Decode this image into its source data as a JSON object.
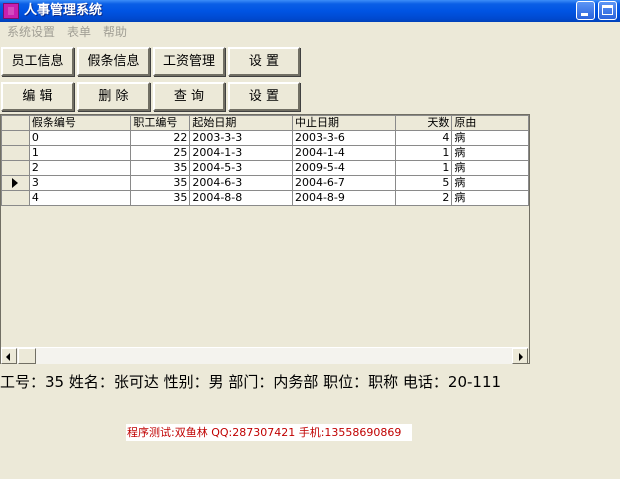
{
  "window": {
    "title": "人事管理系统"
  },
  "menu": [
    "系统设置",
    "表单",
    "帮助"
  ],
  "toolbar_row1": [
    "员工信息",
    "假条信息",
    "工资管理",
    "设  置"
  ],
  "toolbar_row2": [
    "编  辑",
    "删  除",
    "查  询",
    "设  置"
  ],
  "table": {
    "columns": [
      "假条编号",
      "职工编号",
      "起始日期",
      "中止日期",
      "天数",
      "原由"
    ],
    "rows": [
      [
        "0",
        "22",
        "2003-3-3",
        "2003-3-6",
        "4",
        "病"
      ],
      [
        "1",
        "25",
        "2004-1-3",
        "2004-1-4",
        "1",
        "病"
      ],
      [
        "2",
        "35",
        "2004-5-3",
        "2009-5-4",
        "1",
        "病"
      ],
      [
        "3",
        "35",
        "2004-6-3",
        "2004-6-7",
        "5",
        "病"
      ],
      [
        "4",
        "35",
        "2004-8-8",
        "2004-8-9",
        "2",
        "病"
      ]
    ],
    "current_row": 3
  },
  "info_line": "工号：35 姓名：张可达 性别：男 部门：内务部 职位：职称 电话：20-111",
  "credit": "程序测试:双鱼林 QQ:287307421 手机:13558690869",
  "colors": {
    "titlebar": "#0054e3",
    "credit_text": "#c00000"
  }
}
